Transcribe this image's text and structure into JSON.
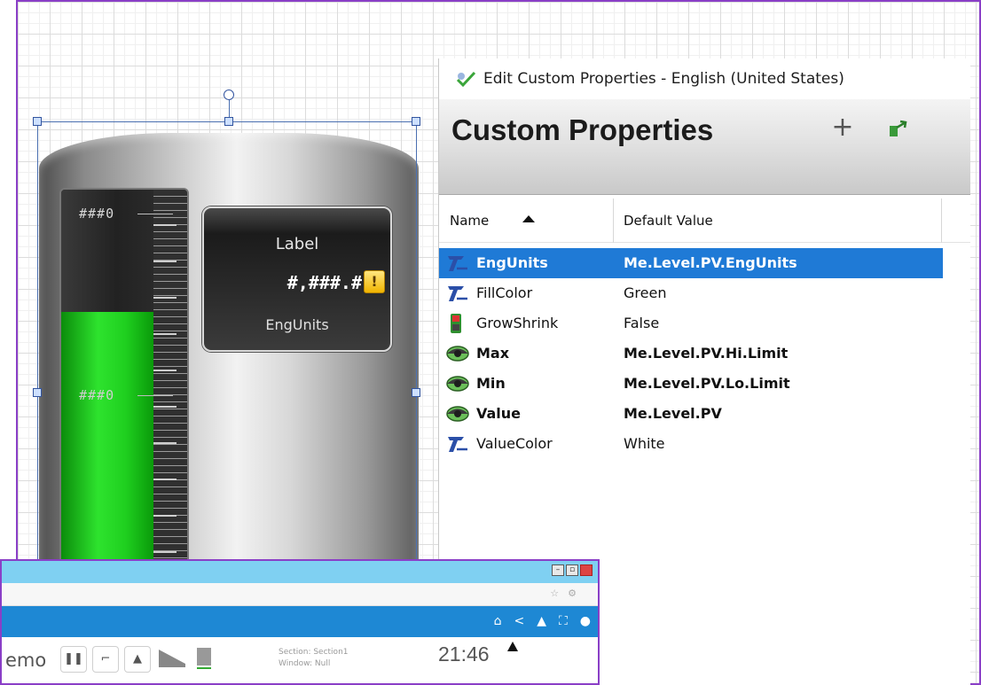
{
  "tank_graphic": {
    "scale_top_label": "###0",
    "scale_mid_label": "###0",
    "value_label": "Label",
    "value_format": "#,###.#",
    "value_units": "EngUnits",
    "fill_color": "#22d822",
    "fill_level": 0.76
  },
  "props_window": {
    "title": "Edit Custom Properties - English (United States)",
    "heading": "Custom Properties",
    "add_button": "+",
    "columns": {
      "name": "Name",
      "default_value": "Default Value"
    },
    "rows": [
      {
        "name": "EngUnits",
        "value": "Me.Level.PV.EngUnits",
        "icon": "text-icon",
        "bold": true,
        "selected": true
      },
      {
        "name": "FillColor",
        "value": "Green",
        "icon": "text-icon",
        "bold": false,
        "selected": false
      },
      {
        "name": "GrowShrink",
        "value": "False",
        "icon": "boolean-icon",
        "bold": false,
        "selected": false
      },
      {
        "name": "Max",
        "value": "Me.Level.PV.Hi.Limit",
        "icon": "eye-icon",
        "bold": true,
        "selected": false
      },
      {
        "name": "Min",
        "value": "Me.Level.PV.Lo.Limit",
        "icon": "eye-icon",
        "bold": true,
        "selected": false
      },
      {
        "name": "Value",
        "value": "Me.Level.PV",
        "icon": "eye-icon",
        "bold": true,
        "selected": false
      },
      {
        "name": "ValueColor",
        "value": "White",
        "icon": "text-icon",
        "bold": false,
        "selected": false
      }
    ],
    "selected_color": "#1f7ad6"
  },
  "browser": {
    "app_text": "emo",
    "section_line": "Section: Section1",
    "window_line": "Window: Null",
    "time": "21:46",
    "titlebar_color": "#7fd0f2",
    "navbar_color": "#1e88d4"
  }
}
